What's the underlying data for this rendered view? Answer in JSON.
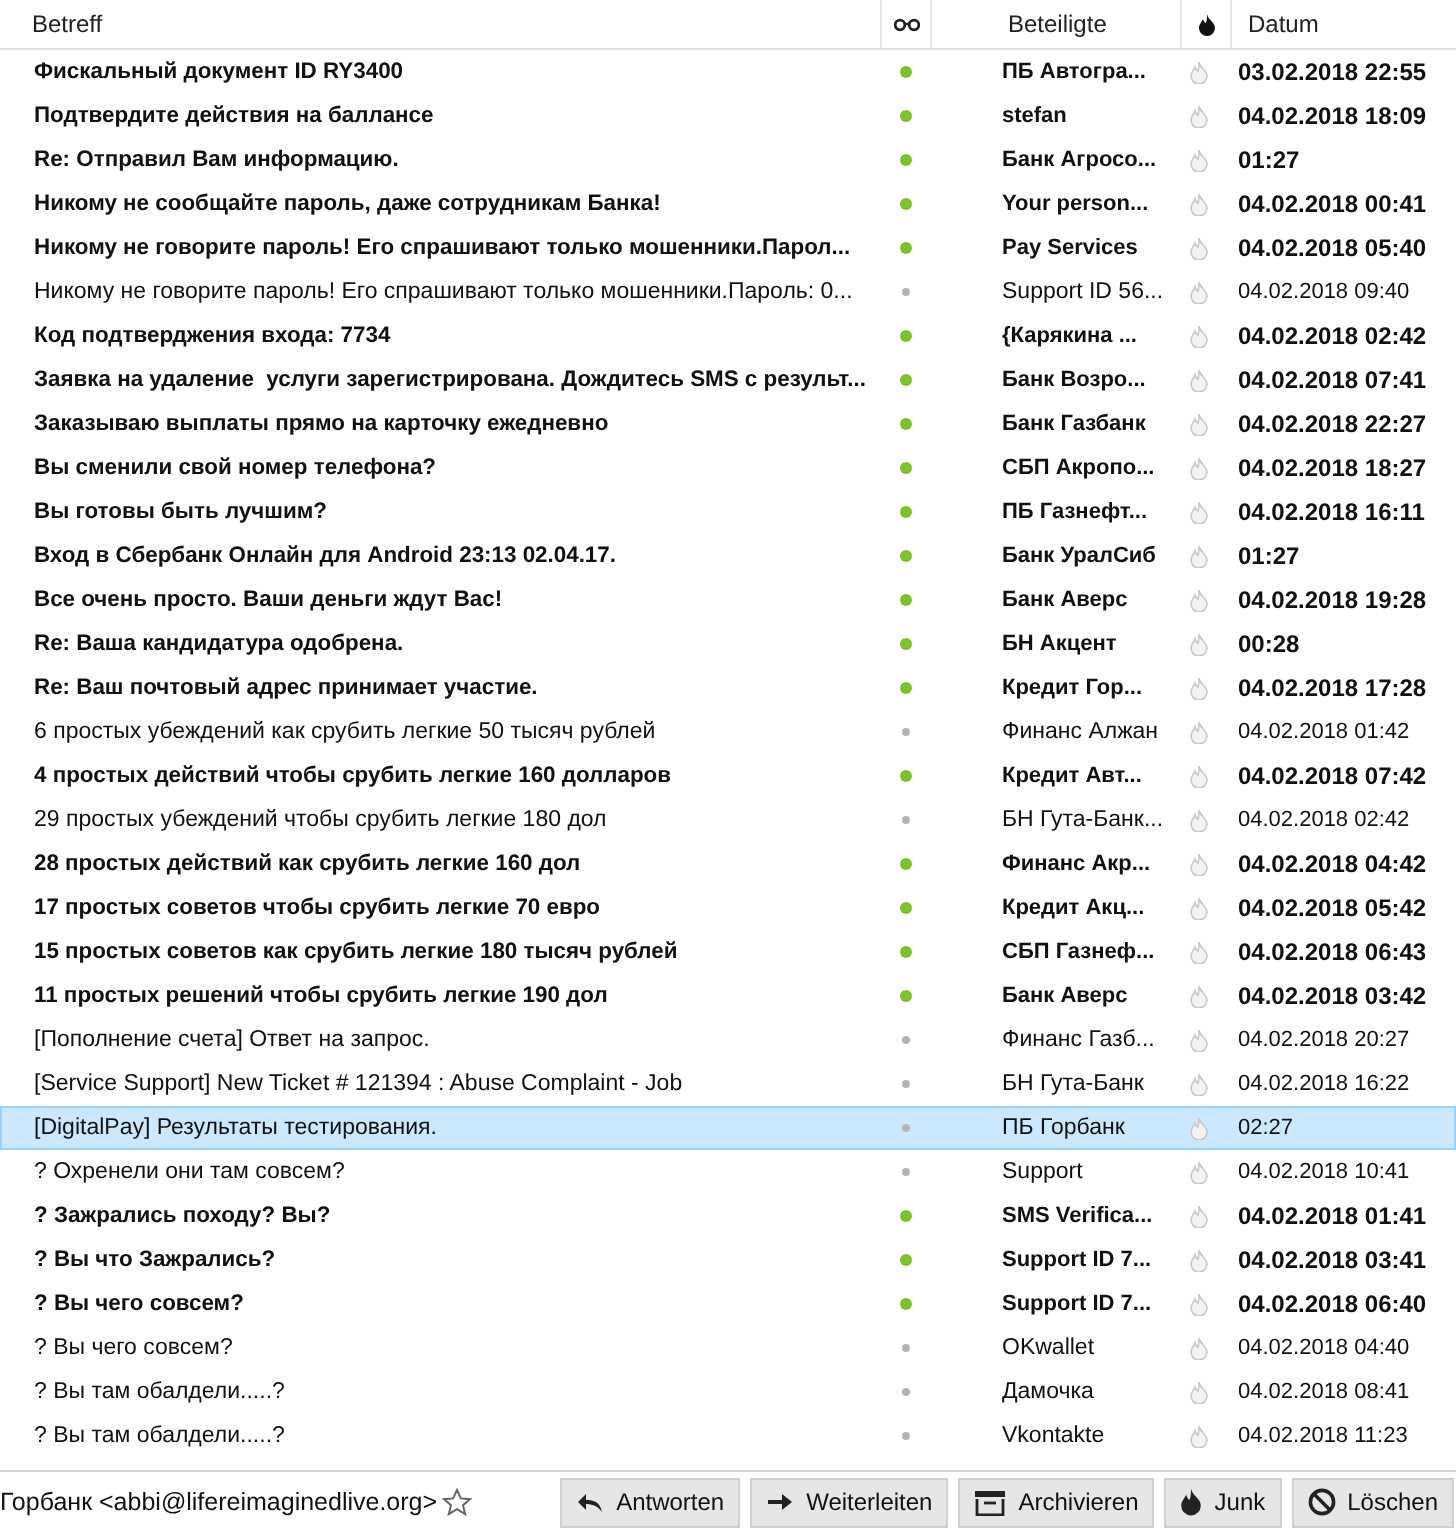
{
  "columns": {
    "subject": "Betreff",
    "participants": "Beteiligte",
    "date": "Datum"
  },
  "messages": [
    {
      "subject": "Фискальный документ ID RY3400",
      "unread": true,
      "sender": "ПБ Автогра...",
      "date": "03.02.2018 22:55",
      "selected": false
    },
    {
      "subject": "Подтвердите действия на баллансе",
      "unread": true,
      "sender": "stefan",
      "date": "04.02.2018 18:09",
      "selected": false
    },
    {
      "subject": "Re: Отправил Вам информацию.",
      "unread": true,
      "sender": "Банк Агросо...",
      "date": "01:27",
      "selected": false
    },
    {
      "subject": "Никому не сообщайте пароль, даже сотрудникам Банка!",
      "unread": true,
      "sender": "Your person...",
      "date": "04.02.2018 00:41",
      "selected": false
    },
    {
      "subject": "Никому не говорите пароль! Его спрашивают только мошенники.Парол...",
      "unread": true,
      "sender": "Pay Services",
      "date": "04.02.2018 05:40",
      "selected": false
    },
    {
      "subject": "Никому не говорите пароль! Его спрашивают только мошенники.Пароль: 0...",
      "unread": false,
      "sender": "Support ID 56...",
      "date": "04.02.2018 09:40",
      "selected": false
    },
    {
      "subject": "Код подтверджения входа: 7734",
      "unread": true,
      "sender": "{Карякина ...",
      "date": "04.02.2018 02:42",
      "selected": false
    },
    {
      "subject": "Заявка на удаление  услуги зарегистрирована. Дождитесь SMS с результ...",
      "unread": true,
      "sender": "Банк Возро...",
      "date": "04.02.2018 07:41",
      "selected": false
    },
    {
      "subject": "Заказываю выплаты прямо на карточку ежедневно",
      "unread": true,
      "sender": "Банк Газбанк",
      "date": "04.02.2018 22:27",
      "selected": false
    },
    {
      "subject": "Вы сменили свой номер телефона?",
      "unread": true,
      "sender": "СБП Акропо...",
      "date": "04.02.2018 18:27",
      "selected": false
    },
    {
      "subject": "Вы готовы быть лучшим?",
      "unread": true,
      "sender": "ПБ Газнефт...",
      "date": "04.02.2018 16:11",
      "selected": false
    },
    {
      "subject": "Вход в Сбербанк Онлайн для Android 23:13 02.04.17.",
      "unread": true,
      "sender": "Банк УралСиб",
      "date": "01:27",
      "selected": false
    },
    {
      "subject": "Все очень просто. Ваши деньги ждут Вас!",
      "unread": true,
      "sender": "Банк Аверс",
      "date": "04.02.2018 19:28",
      "selected": false
    },
    {
      "subject": "Re: Ваша кандидатура одобрена.",
      "unread": true,
      "sender": "БН Акцент",
      "date": "00:28",
      "selected": false
    },
    {
      "subject": "Re: Ваш почтовый адрес принимает участие.",
      "unread": true,
      "sender": "Кредит Гор...",
      "date": "04.02.2018 17:28",
      "selected": false
    },
    {
      "subject": "6 простых убеждений как срубить легкие 50 тысяч рублей",
      "unread": false,
      "sender": "Финанс Алжан",
      "date": "04.02.2018 01:42",
      "selected": false
    },
    {
      "subject": "4 простых действий чтобы срубить легкие 160 долларов",
      "unread": true,
      "sender": "Кредит Авт...",
      "date": "04.02.2018 07:42",
      "selected": false
    },
    {
      "subject": "29 простых убеждений чтобы срубить легкие 180 дол",
      "unread": false,
      "sender": "БН Гута-Банк...",
      "date": "04.02.2018 02:42",
      "selected": false
    },
    {
      "subject": "28 простых действий как срубить легкие 160 дол",
      "unread": true,
      "sender": "Финанс Акр...",
      "date": "04.02.2018 04:42",
      "selected": false
    },
    {
      "subject": "17 простых советов чтобы срубить легкие 70 евро",
      "unread": true,
      "sender": "Кредит Акц...",
      "date": "04.02.2018 05:42",
      "selected": false
    },
    {
      "subject": "15 простых советов как срубить легкие 180 тысяч рублей",
      "unread": true,
      "sender": "СБП Газнеф...",
      "date": "04.02.2018 06:43",
      "selected": false
    },
    {
      "subject": "11 простых решений чтобы срубить легкие 190 дол",
      "unread": true,
      "sender": "Банк Аверс",
      "date": "04.02.2018 03:42",
      "selected": false
    },
    {
      "subject": "[Пополнение счета] Ответ на запрос.",
      "unread": false,
      "sender": "Финанс Газб...",
      "date": "04.02.2018 20:27",
      "selected": false
    },
    {
      "subject": "[Service Support] New Ticket # 121394 : Abuse Complaint - Job",
      "unread": false,
      "sender": "БН Гута-Банк",
      "date": "04.02.2018 16:22",
      "selected": false
    },
    {
      "subject": "[DigitalPay] Результаты тестирования.",
      "unread": false,
      "sender": "ПБ Горбанк",
      "date": "02:27",
      "selected": true
    },
    {
      "subject": "? Охренели они там совсем?",
      "unread": false,
      "sender": "Support",
      "date": "04.02.2018 10:41",
      "selected": false
    },
    {
      "subject": "? Зажрались походу? Вы?",
      "unread": true,
      "sender": "SMS Verifica...",
      "date": "04.02.2018 01:41",
      "selected": false
    },
    {
      "subject": "? Вы что Зажрались?",
      "unread": true,
      "sender": "Support ID 7...",
      "date": "04.02.2018 03:41",
      "selected": false
    },
    {
      "subject": "? Вы чего совсем?",
      "unread": true,
      "sender": "Support ID 7...",
      "date": "04.02.2018 06:40",
      "selected": false
    },
    {
      "subject": "? Вы чего совсем?",
      "unread": false,
      "sender": "OKwallet",
      "date": "04.02.2018 04:40",
      "selected": false
    },
    {
      "subject": "? Вы там обалдели.....?",
      "unread": false,
      "sender": "Дамочка",
      "date": "04.02.2018 08:41",
      "selected": false
    },
    {
      "subject": "? Вы там обалдели.....?",
      "unread": false,
      "sender": "Vkontakte",
      "date": "04.02.2018 11:23",
      "selected": false
    }
  ],
  "footer": {
    "from": "Горбанк <abbi@lifereimaginedlive.org>",
    "buttons": [
      {
        "kind": "reply",
        "label": "Antworten"
      },
      {
        "kind": "forward",
        "label": "Weiterleiten"
      },
      {
        "kind": "archive",
        "label": "Archivieren"
      },
      {
        "kind": "junk",
        "label": "Junk"
      },
      {
        "kind": "delete",
        "label": "Löschen"
      }
    ]
  }
}
